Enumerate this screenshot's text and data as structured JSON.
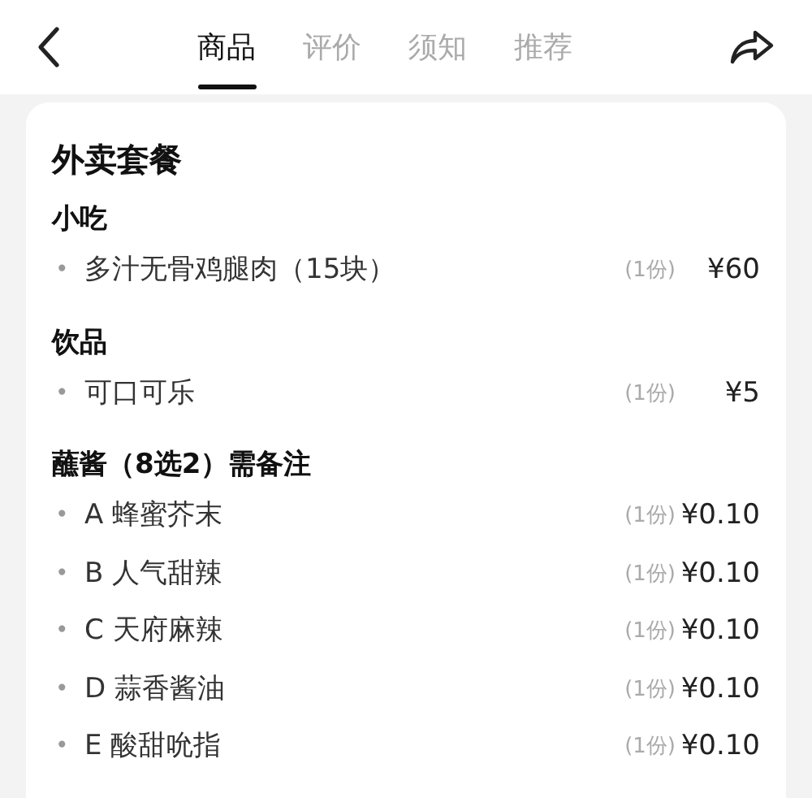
{
  "tabs": [
    {
      "label": "商品",
      "selected": true
    },
    {
      "label": "评价",
      "selected": false
    },
    {
      "label": "须知",
      "selected": false
    },
    {
      "label": "推荐",
      "selected": false
    }
  ],
  "card": {
    "title": "外卖套餐",
    "sections": [
      {
        "heading": "小吃",
        "items": [
          {
            "bullet": "•",
            "name": "多汁无骨鸡腿肉（15块）",
            "quantity": "(1份)",
            "price": "¥60"
          }
        ]
      },
      {
        "heading": "饮品",
        "items": [
          {
            "bullet": "•",
            "name": "可口可乐",
            "quantity": "(1份)",
            "price": "¥5"
          }
        ]
      },
      {
        "heading": "蘸酱（8选2）需备注",
        "items": [
          {
            "bullet": "•",
            "name": "A 蜂蜜芥末",
            "quantity": "(1份)",
            "price": "¥0.10"
          },
          {
            "bullet": "•",
            "name": "B 人气甜辣",
            "quantity": "(1份)",
            "price": "¥0.10"
          },
          {
            "bullet": "•",
            "name": "C 天府麻辣",
            "quantity": "(1份)",
            "price": "¥0.10"
          },
          {
            "bullet": "•",
            "name": "D 蒜香酱油",
            "quantity": "(1份)",
            "price": "¥0.10"
          },
          {
            "bullet": "•",
            "name": "E 酸甜吮指",
            "quantity": "(1份)",
            "price": "¥0.10"
          }
        ]
      }
    ]
  }
}
